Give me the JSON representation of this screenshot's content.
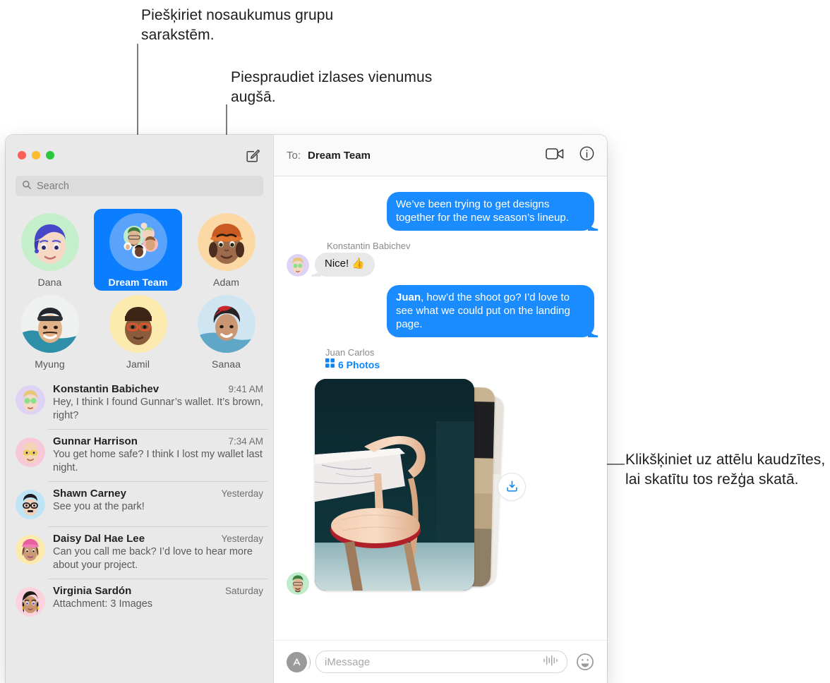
{
  "annotations": [
    {
      "id": "a1",
      "text": "Piešķiriet nosaukumus grupu sarakstēm."
    },
    {
      "id": "a2",
      "text": "Piespraudiet izlases vienumus augšā."
    },
    {
      "id": "a3",
      "text": "Klikšķiniet uz attēlu kaudzītes, lai skatītu tos režģa skatā."
    }
  ],
  "window": {
    "titlebar": {
      "traffic_lights": [
        "close",
        "minimize",
        "zoom"
      ],
      "compose_icon": "compose-icon"
    },
    "search": {
      "placeholder": "Search",
      "icon": "search-icon"
    }
  },
  "sidebar": {
    "pins": [
      {
        "label": "Dana",
        "selected": false,
        "avatar": "memoji-dana"
      },
      {
        "label": "Dream Team",
        "selected": true,
        "avatar": "group-dream-team"
      },
      {
        "label": "Adam",
        "selected": false,
        "avatar": "memoji-adam"
      },
      {
        "label": "Myung",
        "selected": false,
        "avatar": "photo-myung"
      },
      {
        "label": "Jamil",
        "selected": false,
        "avatar": "memoji-jamil"
      },
      {
        "label": "Sanaa",
        "selected": false,
        "avatar": "photo-sanaa"
      }
    ],
    "conversations": [
      {
        "name": "Konstantin Babichev",
        "time": "9:41 AM",
        "preview": "Hey, I think I found Gunnar’s wallet. It’s brown, right?",
        "avatar": "memoji-konstantin"
      },
      {
        "name": "Gunnar Harrison",
        "time": "7:34 AM",
        "preview": "You get home safe? I think I lost my wallet last night.",
        "avatar": "memoji-gunnar"
      },
      {
        "name": "Shawn Carney",
        "time": "Yesterday",
        "preview": "See you at the park!",
        "avatar": "memoji-shawn"
      },
      {
        "name": "Daisy Dal Hae Lee",
        "time": "Yesterday",
        "preview": "Can you call me back? I’d love to hear more about your project.",
        "avatar": "memoji-daisy"
      },
      {
        "name": "Virginia Sardón",
        "time": "Saturday",
        "preview": "Attachment: 3 Images",
        "avatar": "memoji-virginia"
      }
    ]
  },
  "thread": {
    "header": {
      "to_label": "To:",
      "to_name": "Dream Team",
      "facetime_icon": "video-camera-icon",
      "info_icon": "info-circle-icon"
    },
    "messages": [
      {
        "kind": "outgoing",
        "text": "We’ve been trying to get designs together for the new season’s lineup."
      },
      {
        "kind": "incoming",
        "sender": "Konstantin Babichev",
        "text": "Nice! 👍",
        "avatar": "memoji-konstantin"
      },
      {
        "kind": "outgoing",
        "lead_bold": "Juan",
        "text": ", how’d the shoot go? I’d love to see what we could put on the landing page."
      }
    ],
    "photo_attachment": {
      "sender": "Juan Carlos",
      "count_label": "6 Photos",
      "grid_icon": "photo-grid-icon",
      "avatar": "memoji-juan",
      "download_icon": "download-icon",
      "layers": 3
    },
    "composer": {
      "apps_icon": "apps-store-icon",
      "placeholder": "iMessage",
      "audio_icon": "audio-waveform-icon",
      "emoji_icon": "emoji-smiley-icon"
    }
  },
  "colors": {
    "accent_blue": "#0b7eff",
    "bubble_out": "#1a8cff",
    "bubble_in": "#e8e8e8",
    "sidebar_bg": "#e9e9e9",
    "link_blue": "#0a84ff"
  }
}
